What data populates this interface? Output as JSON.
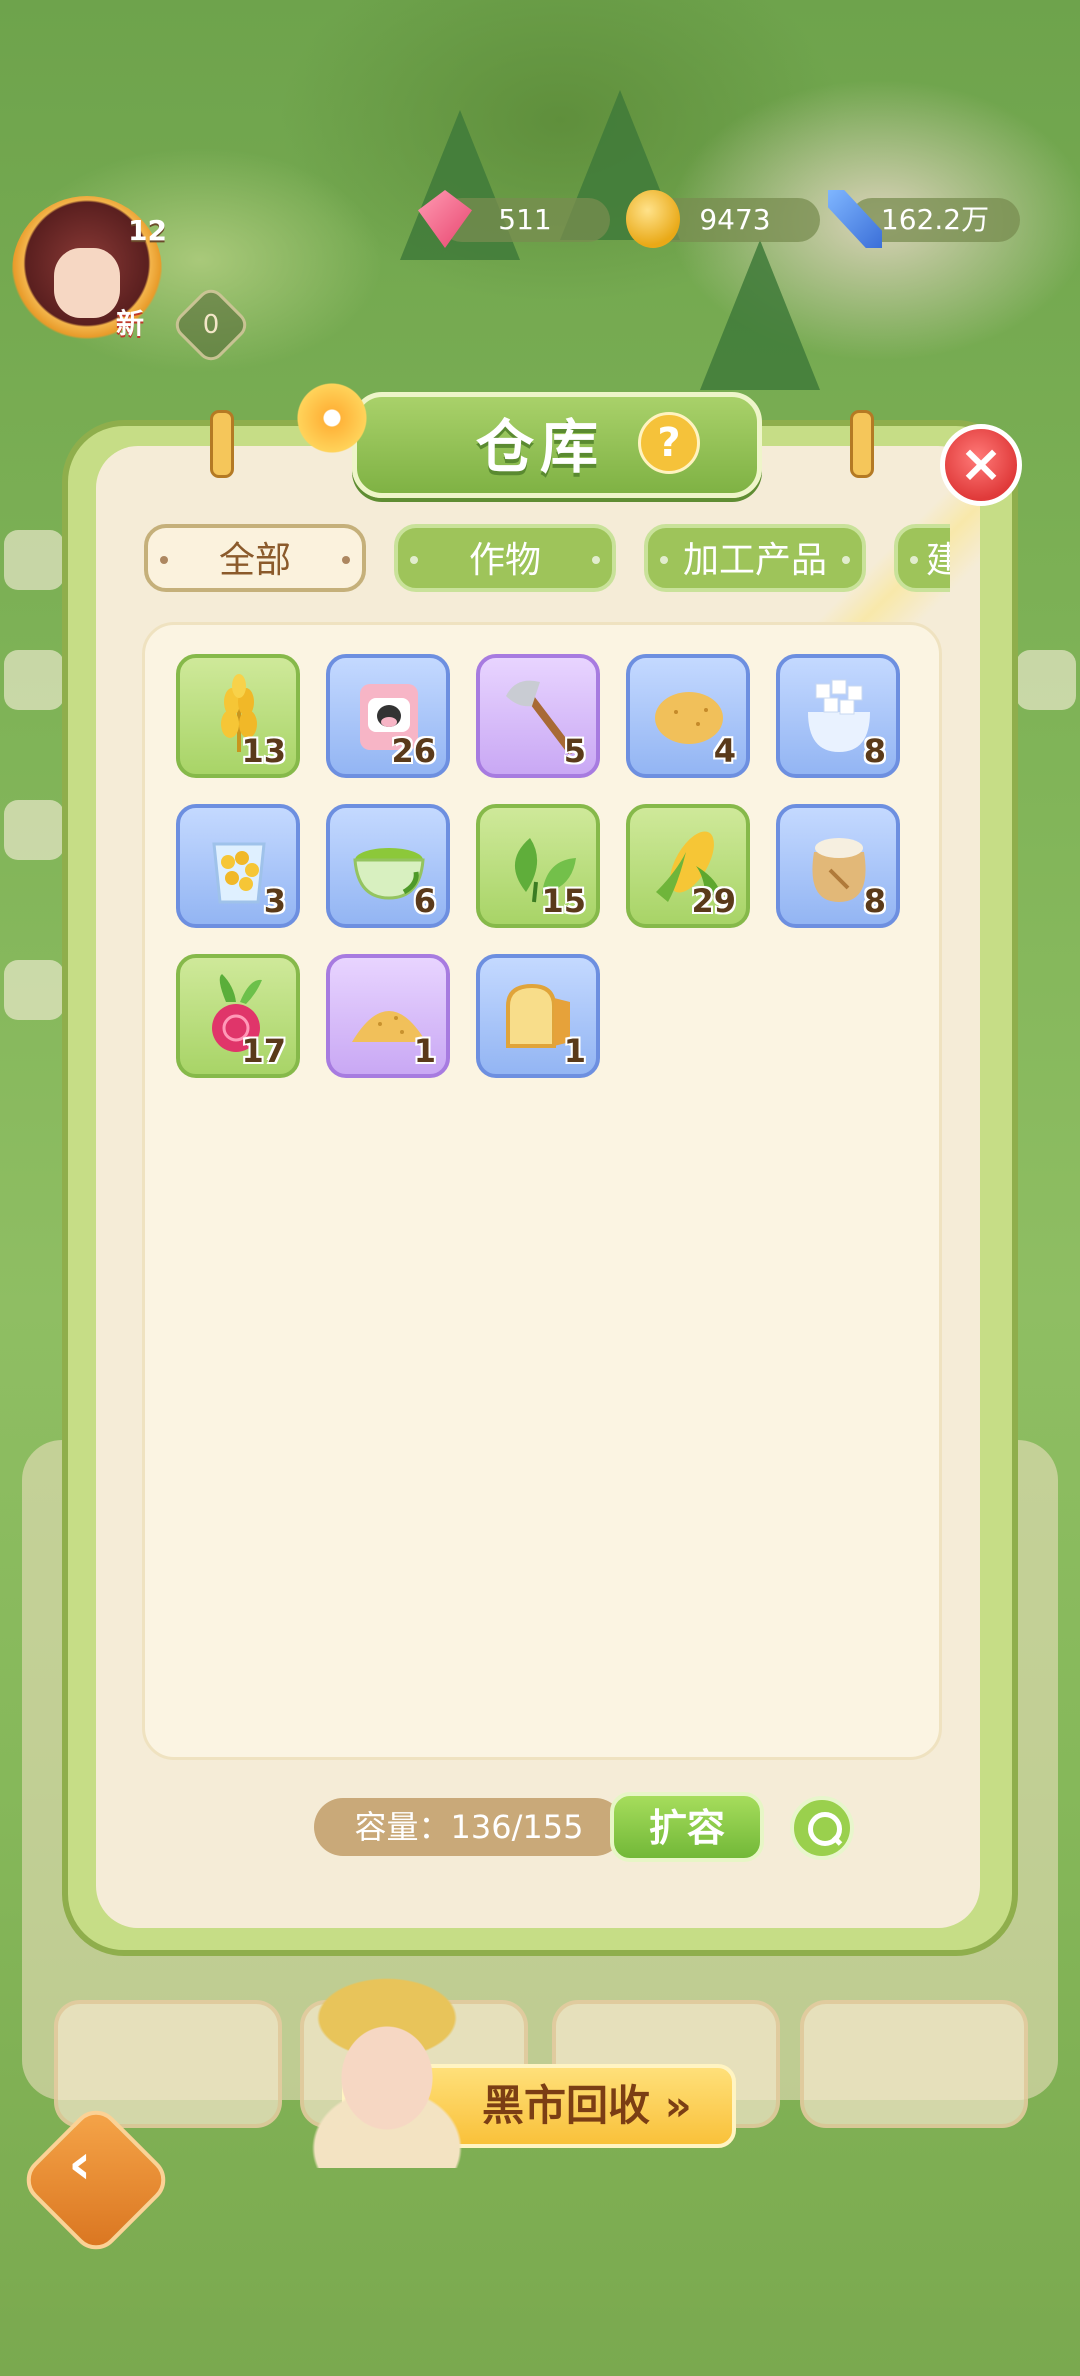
{
  "hud": {
    "level": "12",
    "new_label": "新",
    "badge_count": "0",
    "gems": "511",
    "coins": "9473",
    "power": "162.2万"
  },
  "warehouse": {
    "title": "仓库",
    "help": "?",
    "close": "×",
    "tabs": [
      {
        "label": "全部",
        "active": true
      },
      {
        "label": "作物",
        "active": false
      },
      {
        "label": "加工产品",
        "active": false
      },
      {
        "label": "建",
        "active": false
      }
    ],
    "items": [
      {
        "icon": "wheat-icon",
        "count": "13",
        "frame": "green"
      },
      {
        "icon": "milk-carton-icon",
        "count": "26",
        "frame": "blue"
      },
      {
        "icon": "axe-icon",
        "count": "5",
        "frame": "purple"
      },
      {
        "icon": "potato-icon",
        "count": "4",
        "frame": "blue"
      },
      {
        "icon": "sugar-bag-icon",
        "count": "8",
        "frame": "blue"
      },
      {
        "icon": "corn-cup-icon",
        "count": "3",
        "frame": "blue"
      },
      {
        "icon": "matcha-bowl-icon",
        "count": "6",
        "frame": "blue"
      },
      {
        "icon": "tea-leaf-icon",
        "count": "15",
        "frame": "green"
      },
      {
        "icon": "corn-icon",
        "count": "29",
        "frame": "green"
      },
      {
        "icon": "flour-sack-icon",
        "count": "8",
        "frame": "blue"
      },
      {
        "icon": "beet-icon",
        "count": "17",
        "frame": "green"
      },
      {
        "icon": "powder-pile-icon",
        "count": "1",
        "frame": "purple"
      },
      {
        "icon": "bread-icon",
        "count": "1",
        "frame": "blue"
      }
    ],
    "capacity_label": "容量：136/155",
    "expand_label": "扩容"
  },
  "black_market": {
    "label": "黑市回收",
    "arrow": "»"
  },
  "colors": {
    "accent_green": "#8fae4c",
    "panel_cream": "#f5ecd7",
    "count_text": "#5a3a1a",
    "close_red": "#e03a3a"
  }
}
